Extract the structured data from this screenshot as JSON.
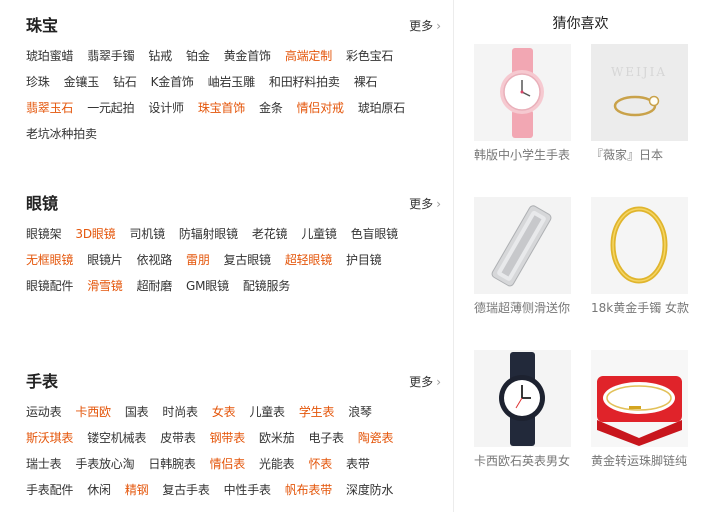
{
  "sections": [
    {
      "title": "珠宝",
      "more": "更多",
      "rows": [
        [
          {
            "t": "琥珀蜜蜡",
            "hot": false
          },
          {
            "t": "翡翠手镯",
            "hot": false
          },
          {
            "t": "钻戒",
            "hot": false
          },
          {
            "t": "铂金",
            "hot": false
          },
          {
            "t": "黄金首饰",
            "hot": false
          },
          {
            "t": "高端定制",
            "hot": true
          },
          {
            "t": "彩色宝石",
            "hot": false
          }
        ],
        [
          {
            "t": "珍珠",
            "hot": false
          },
          {
            "t": "金镶玉",
            "hot": false
          },
          {
            "t": "钻石",
            "hot": false
          },
          {
            "t": "K金首饰",
            "hot": false
          },
          {
            "t": "岫岩玉雕",
            "hot": false
          },
          {
            "t": "和田籽料拍卖",
            "hot": false
          },
          {
            "t": "裸石",
            "hot": false
          }
        ],
        [
          {
            "t": "翡翠玉石",
            "hot": true
          },
          {
            "t": "一元起拍",
            "hot": false
          },
          {
            "t": "设计师",
            "hot": false
          },
          {
            "t": "珠宝首饰",
            "hot": true
          },
          {
            "t": "金条",
            "hot": false
          },
          {
            "t": "情侣对戒",
            "hot": true
          },
          {
            "t": "琥珀原石",
            "hot": false
          }
        ],
        [
          {
            "t": "老坑冰种拍卖",
            "hot": false
          }
        ]
      ]
    },
    {
      "title": "眼镜",
      "more": "更多",
      "rows": [
        [
          {
            "t": "眼镜架",
            "hot": false
          },
          {
            "t": "3D眼镜",
            "hot": true
          },
          {
            "t": "司机镜",
            "hot": false
          },
          {
            "t": "防辐射眼镜",
            "hot": false
          },
          {
            "t": "老花镜",
            "hot": false
          },
          {
            "t": "儿童镜",
            "hot": false
          },
          {
            "t": "色盲眼镜",
            "hot": false
          }
        ],
        [
          {
            "t": "无框眼镜",
            "hot": true
          },
          {
            "t": "眼镜片",
            "hot": false
          },
          {
            "t": "依视路",
            "hot": false
          },
          {
            "t": "雷朋",
            "hot": true
          },
          {
            "t": "复古眼镜",
            "hot": false
          },
          {
            "t": "超轻眼镜",
            "hot": true
          },
          {
            "t": "护目镜",
            "hot": false
          }
        ],
        [
          {
            "t": "眼镜配件",
            "hot": false
          },
          {
            "t": "滑雪镜",
            "hot": true
          },
          {
            "t": "超耐磨",
            "hot": false
          },
          {
            "t": "GM眼镜",
            "hot": false
          },
          {
            "t": "配镜服务",
            "hot": false
          }
        ]
      ]
    },
    {
      "title": "手表",
      "more": "更多",
      "rows": [
        [
          {
            "t": "运动表",
            "hot": false
          },
          {
            "t": "卡西欧",
            "hot": true
          },
          {
            "t": "国表",
            "hot": false
          },
          {
            "t": "时尚表",
            "hot": false
          },
          {
            "t": "女表",
            "hot": true
          },
          {
            "t": "儿童表",
            "hot": false
          },
          {
            "t": "学生表",
            "hot": true
          },
          {
            "t": "浪琴",
            "hot": false
          }
        ],
        [
          {
            "t": "斯沃琪表",
            "hot": true
          },
          {
            "t": "镂空机械表",
            "hot": false
          },
          {
            "t": "皮带表",
            "hot": false
          },
          {
            "t": "钢带表",
            "hot": true
          },
          {
            "t": "欧米茄",
            "hot": false
          },
          {
            "t": "电子表",
            "hot": false
          },
          {
            "t": "陶瓷表",
            "hot": true
          }
        ],
        [
          {
            "t": "瑞士表",
            "hot": false
          },
          {
            "t": "手表放心淘",
            "hot": false
          },
          {
            "t": "日韩腕表",
            "hot": false
          },
          {
            "t": "情侣表",
            "hot": true
          },
          {
            "t": "光能表",
            "hot": false
          },
          {
            "t": "怀表",
            "hot": true
          },
          {
            "t": "表带",
            "hot": false
          }
        ],
        [
          {
            "t": "手表配件",
            "hot": false
          },
          {
            "t": "休闲",
            "hot": false
          },
          {
            "t": "精钢",
            "hot": true
          },
          {
            "t": "复古手表",
            "hot": false
          },
          {
            "t": "中性手表",
            "hot": false
          },
          {
            "t": "帆布表带",
            "hot": true
          },
          {
            "t": "深度防水",
            "hot": false
          }
        ]
      ]
    }
  ],
  "guess": {
    "title": "猜你喜欢",
    "products": [
      {
        "caption": "韩版中小学生手表",
        "icon": "pink-watch-image"
      },
      {
        "caption": "『薇家』日本",
        "icon": "gold-ring-image",
        "img_text": "WEIJIA"
      },
      {
        "caption": "德瑞超薄侧滑送你",
        "icon": "silver-lighter-image"
      },
      {
        "caption": "18k黄金手镯 女款",
        "icon": "gold-bangle-image"
      },
      {
        "caption": "卡西欧石英表男女",
        "icon": "black-watch-image"
      },
      {
        "caption": "黄金转运珠脚链纯",
        "icon": "gold-anklet-box-image"
      }
    ]
  },
  "colors": {
    "hot": "#e4560b",
    "text": "#333333",
    "caption": "#777777"
  }
}
